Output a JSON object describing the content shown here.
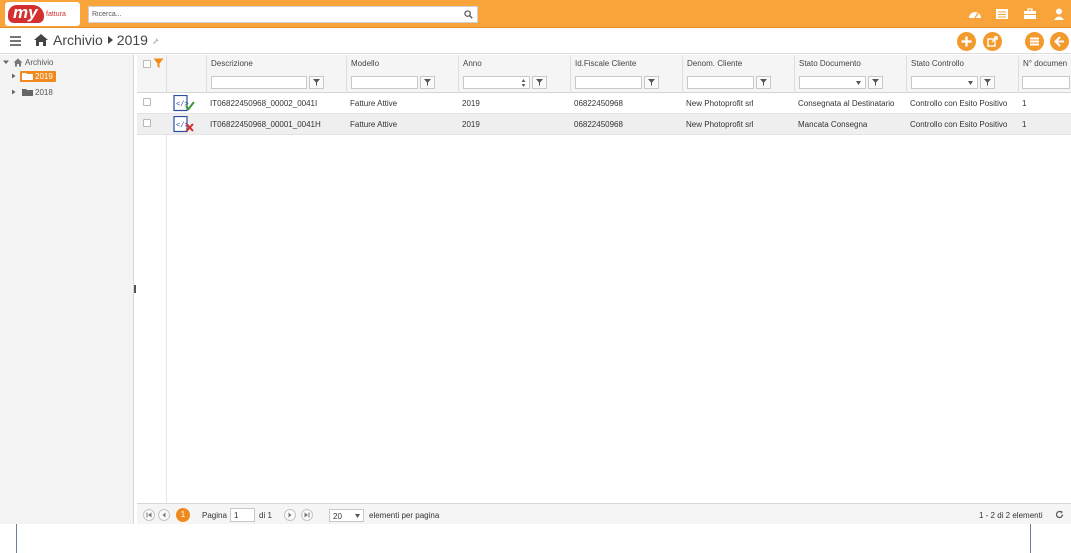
{
  "brand": {
    "logo_text": "my",
    "logo_sub": "fattura"
  },
  "search": {
    "placeholder": "Ricerca..."
  },
  "breadcrumb": {
    "root": "Archivio",
    "current": "2019"
  },
  "tree": {
    "root": "Archivio",
    "items": [
      {
        "label": "2019",
        "selected": true
      },
      {
        "label": "2018",
        "selected": false
      }
    ]
  },
  "columns": [
    {
      "label": "Descrizione"
    },
    {
      "label": "Modello"
    },
    {
      "label": "Anno"
    },
    {
      "label": "Id.Fiscale Cliente"
    },
    {
      "label": "Denom. Cliente"
    },
    {
      "label": "Stato Documento"
    },
    {
      "label": "Stato Controllo"
    },
    {
      "label": "N° documen"
    }
  ],
  "rows": [
    {
      "icon": "xml-document-ok-icon",
      "descrizione": "IT06822450968_00002_0041I",
      "modello": "Fatture Attive",
      "anno": "2019",
      "id_fiscale": "06822450968",
      "denom": "New Photoprofit srl",
      "stato_doc": "Consegnata al Destinatario",
      "stato_ctrl": "Controllo con Esito Positivo",
      "n_doc": "1"
    },
    {
      "icon": "xml-document-error-icon",
      "descrizione": "IT06822450968_00001_0041H",
      "modello": "Fatture Attive",
      "anno": "2019",
      "id_fiscale": "06822450968",
      "denom": "New Photoprofit srl",
      "stato_doc": "Mancata Consegna",
      "stato_ctrl": "Controllo con Esito Positivo",
      "n_doc": "1"
    }
  ],
  "pager": {
    "current_page": "1",
    "page_label": "Pagina",
    "page_value": "1",
    "of_label": "di 1",
    "page_size": "20",
    "page_size_label": "elementi per pagina",
    "summary": "1 - 2 di 2 elementi"
  },
  "colors": {
    "accent": "#f9a33b",
    "selected": "#f08a1c",
    "brand_red": "#d32f2f"
  }
}
